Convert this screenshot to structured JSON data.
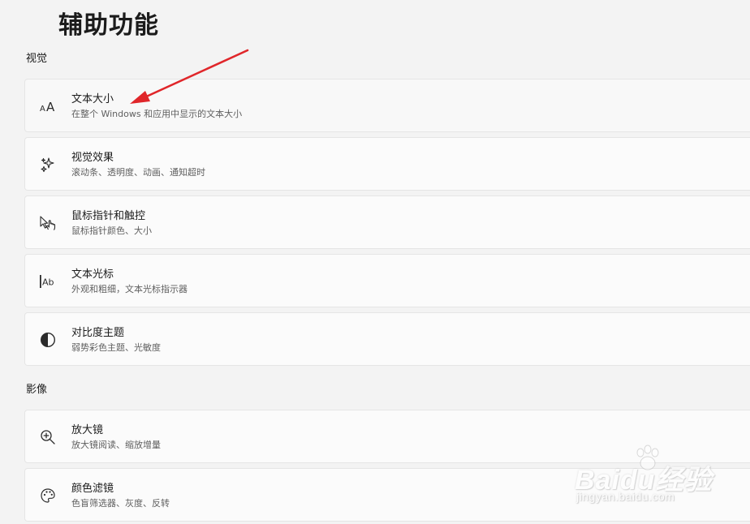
{
  "page": {
    "title": "辅助功能"
  },
  "sections": [
    {
      "header": "视觉",
      "items": [
        {
          "title": "文本大小",
          "subtitle": "在整个 Windows 和应用中显示的文本大小",
          "icon": "text-size-icon"
        },
        {
          "title": "视觉效果",
          "subtitle": "滚动条、透明度、动画、通知超时",
          "icon": "visual-effects-icon"
        },
        {
          "title": "鼠标指针和触控",
          "subtitle": "鼠标指针颜色、大小",
          "icon": "mouse-pointer-touch-icon"
        },
        {
          "title": "文本光标",
          "subtitle": "外观和粗细，文本光标指示器",
          "icon": "text-cursor-icon"
        },
        {
          "title": "对比度主题",
          "subtitle": "弱势彩色主题、光敏度",
          "icon": "contrast-icon"
        }
      ]
    },
    {
      "header": "影像",
      "items": [
        {
          "title": "放大镜",
          "subtitle": "放大镜阅读、缩放增量",
          "icon": "magnifier-icon"
        },
        {
          "title": "颜色滤镜",
          "subtitle": "色盲筛选器、灰度、反转",
          "icon": "color-filter-icon"
        }
      ]
    }
  ],
  "annotation": {
    "arrow_color": "#e0262a"
  },
  "watermark": {
    "logo_text": "Baidu经验",
    "url": "jingyan.baidu.com"
  },
  "colors": {
    "background": "#f3f3f3",
    "card": "#fbfbfb",
    "card_border": "#e5e5e5",
    "title_text": "#1b1b1b",
    "subtitle_text": "#5f5f5f"
  }
}
